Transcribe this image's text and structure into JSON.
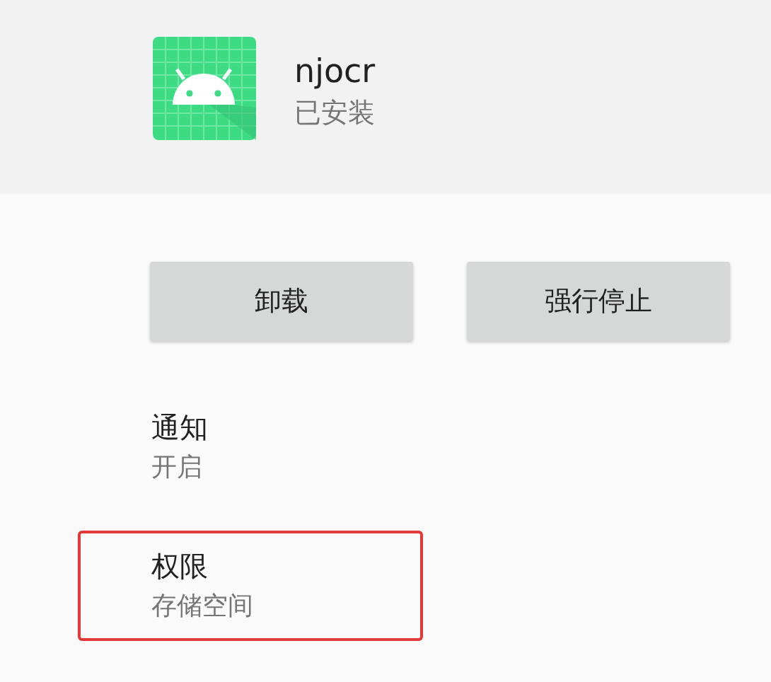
{
  "app": {
    "name": "njocr",
    "status": "已安装"
  },
  "buttons": [
    "卸载",
    "强行停止"
  ],
  "settings": [
    {
      "title": "通知",
      "summary": "开启",
      "highlighted": false
    },
    {
      "title": "权限",
      "summary": "存储空间",
      "highlighted": true
    }
  ]
}
